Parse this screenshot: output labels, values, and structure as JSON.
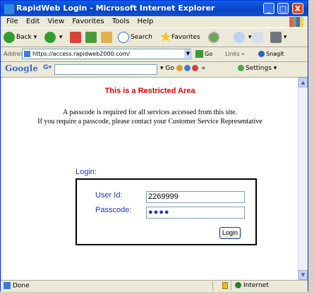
{
  "window": {
    "title": "RapidWeb Login - Microsoft Internet Explorer",
    "controls": {
      "minimize": "_",
      "maximize": "□",
      "close": "X"
    }
  },
  "menu": [
    "File",
    "Edit",
    "View",
    "Favorites",
    "Tools",
    "Help"
  ],
  "toolbar": {
    "back_label": "Back",
    "search_label": "Search",
    "favorites_label": "Favorites"
  },
  "address_bar": {
    "label": "Address",
    "url": "https://access.rapidweb2000.com/",
    "go_label": "Go",
    "links_label": "Links",
    "snagit_label": "SnagIt"
  },
  "google_bar": {
    "logo": "Google",
    "dropdown_prefix": "G",
    "go_label": "Go",
    "settings_label": "Settings"
  },
  "page": {
    "restricted_title": "This is a Restricted Area",
    "info_line_1": "A passcode is required for all services accessed from this site.",
    "info_line_2": "If you require a passcode, please contact your Customer Service Representative",
    "login_heading": "Login:",
    "user_id_label": "User Id:",
    "user_id_value": "2269999",
    "passcode_label": "Passcode:",
    "passcode_value": "●●●●",
    "login_button": "Login"
  },
  "status_bar": {
    "status_text": "Done",
    "zone_text": "Internet"
  },
  "colors": {
    "title_bar": "#0842c6",
    "restricted_red": "#e00000",
    "label_blue": "#2431b8"
  }
}
